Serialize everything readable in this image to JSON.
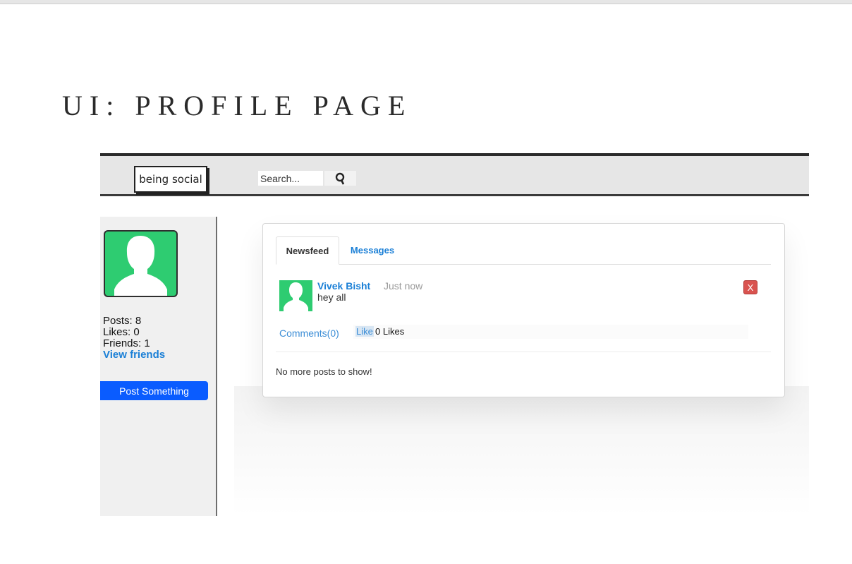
{
  "slide": {
    "title": "UI: PROFILE PAGE"
  },
  "navbar": {
    "brand": "being social",
    "search_placeholder": "Search..."
  },
  "sidebar": {
    "posts": "Posts: 8",
    "likes": "Likes: 0",
    "friends": "Friends: 1",
    "view_friends": "View friends",
    "post_button": "Post Something"
  },
  "tabs": [
    {
      "label": "Newsfeed",
      "active": true
    },
    {
      "label": "Messages",
      "active": false
    }
  ],
  "post": {
    "author": "Vivek Bisht",
    "time": "Just now",
    "text": "hey all",
    "delete_label": "X",
    "comments": "Comments(0)",
    "like_label": "Like",
    "likes_count": "0 Likes"
  },
  "feed_footer": "No more posts to show!",
  "colors": {
    "accent": "#1a7fd6",
    "avatar": "#2ecc71",
    "post_button": "#0a5cff",
    "delete": "#d9534f"
  },
  "icons": {
    "search": "search-icon",
    "avatar": "user-silhouette-icon"
  }
}
